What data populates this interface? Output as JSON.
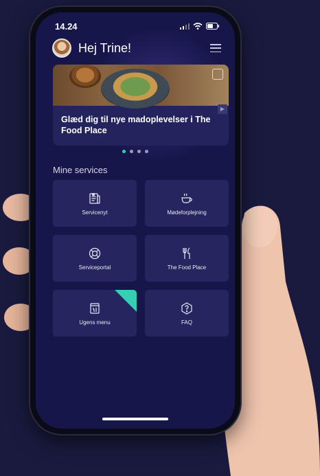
{
  "status": {
    "time": "14.24"
  },
  "header": {
    "greeting": "Hej Trine!"
  },
  "banner": {
    "title": "Glæd dig til nye madoplevelser i The Food Place"
  },
  "carousel": {
    "count": 4,
    "active_index": 0
  },
  "services": {
    "title": "Mine services",
    "items": [
      {
        "label": "Servicenyt",
        "icon": "news-icon"
      },
      {
        "label": "Mødeforplejning",
        "icon": "coffee-cup-icon"
      },
      {
        "label": "Serviceportal",
        "icon": "lifebuoy-icon"
      },
      {
        "label": "The Food Place",
        "icon": "fork-knife-icon"
      },
      {
        "label": "Ugens menu",
        "icon": "menu-book-icon"
      },
      {
        "label": "FAQ",
        "icon": "question-icon"
      }
    ]
  },
  "colors": {
    "accent": "#35d0b4",
    "background": "#16164a",
    "tile": "#25255f"
  }
}
